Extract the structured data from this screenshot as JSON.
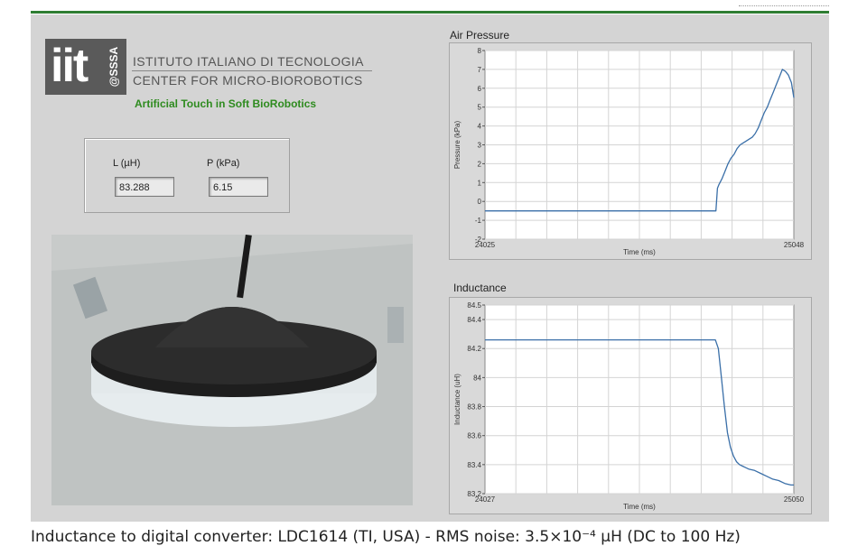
{
  "logo": {
    "mark": "iit",
    "affiliation": "@SSSA",
    "org_name": "ISTITUTO ITALIANO DI TECNOLOGIA",
    "center": "CENTER FOR MICRO-BIOROBOTICS",
    "tagline": "Artificial Touch in Soft BioRobotics"
  },
  "readouts": {
    "inductance_label": "L (µH)",
    "inductance_value": "83.288",
    "pressure_label": "P (kPa)",
    "pressure_value": "6.15"
  },
  "photo": {
    "subject": "soft dome tactile sensor"
  },
  "caption": "Inductance to digital converter: LDC1614 (TI, USA) - RMS noise: 3.5×10⁻⁴ µH (DC to 100 Hz)",
  "colors": {
    "trace": "#3a6fa8",
    "panel": "#d4d4d4",
    "brand_green": "#2e8b1f"
  },
  "chart_data": [
    {
      "type": "line",
      "title": "Air Pressure",
      "xlabel": "Time (ms)",
      "ylabel": "Pressure (kPa)",
      "x_tick_labels": [
        "24025",
        "25048"
      ],
      "xlim": [
        24025,
        25048
      ],
      "ylim": [
        -2,
        8
      ],
      "y_ticks": [
        -2,
        -1,
        0,
        1,
        2,
        3,
        4,
        5,
        6,
        7,
        8
      ],
      "y_tick_labels": [
        "-2",
        "-1",
        "0",
        "1",
        "2",
        "3",
        "4",
        "5",
        "6",
        "7",
        "8"
      ],
      "grid": true,
      "series": [
        {
          "x": [
            24025,
            24100,
            24200,
            24300,
            24400,
            24500,
            24600,
            24700,
            24790,
            24795,
            24800,
            24810,
            24820,
            24830,
            24840,
            24850,
            24860,
            24870,
            24880,
            24890,
            24900,
            24910,
            24920,
            24930,
            24940,
            24950,
            24960,
            24970,
            24980,
            24990,
            25000,
            25010,
            25020,
            25030,
            25040,
            25048
          ],
          "y": [
            -0.5,
            -0.5,
            -0.5,
            -0.5,
            -0.5,
            -0.5,
            -0.5,
            -0.5,
            -0.5,
            0.7,
            0.9,
            1.2,
            1.6,
            2.0,
            2.3,
            2.5,
            2.8,
            3.0,
            3.1,
            3.2,
            3.3,
            3.4,
            3.6,
            3.9,
            4.3,
            4.7,
            5.0,
            5.4,
            5.8,
            6.2,
            6.6,
            7.0,
            6.9,
            6.7,
            6.3,
            5.5
          ]
        }
      ]
    },
    {
      "type": "line",
      "title": "Inductance",
      "xlabel": "Time (ms)",
      "ylabel": "Inductance (uH)",
      "x_tick_labels": [
        "24027",
        "25050"
      ],
      "xlim": [
        24027,
        25050
      ],
      "ylim": [
        83.2,
        84.5
      ],
      "y_ticks": [
        83.2,
        83.4,
        83.6,
        83.8,
        84,
        84.2,
        84.4,
        84.5
      ],
      "y_tick_labels": [
        "83.2",
        "83.4",
        "83.6",
        "83.8",
        "84",
        "84.2",
        "84.4",
        "84.5"
      ],
      "grid": true,
      "series": [
        {
          "x": [
            24027,
            24100,
            24200,
            24300,
            24400,
            24500,
            24600,
            24700,
            24790,
            24800,
            24810,
            24820,
            24830,
            24840,
            24850,
            24860,
            24870,
            24880,
            24890,
            24900,
            24920,
            24940,
            24960,
            24980,
            25000,
            25020,
            25040,
            25050
          ],
          "y": [
            84.26,
            84.26,
            84.26,
            84.26,
            84.26,
            84.26,
            84.26,
            84.26,
            84.26,
            84.2,
            84.0,
            83.8,
            83.62,
            83.52,
            83.46,
            83.42,
            83.4,
            83.39,
            83.38,
            83.37,
            83.36,
            83.34,
            83.32,
            83.3,
            83.29,
            83.27,
            83.26,
            83.26
          ]
        }
      ]
    }
  ]
}
